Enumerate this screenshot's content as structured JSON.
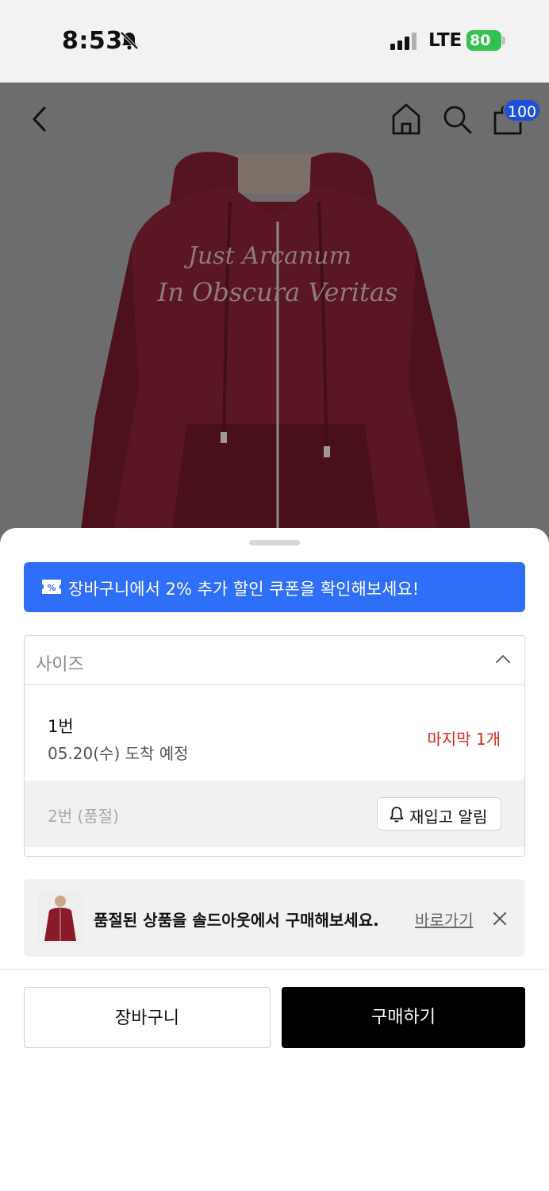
{
  "status_bar": {
    "time": "8:53",
    "network": "LTE",
    "battery": "80"
  },
  "top_nav": {
    "cart_count": "100"
  },
  "hero": {
    "print_line1": "Just Arcanum",
    "print_line2": "In Obscura Veritas"
  },
  "coupon_banner": {
    "text": "장바구니에서 2% 추가 할인 쿠폰을 확인해보세요!"
  },
  "option_select": {
    "label": "사이즈",
    "options": [
      {
        "name": "1번",
        "delivery": "05.20(수) 도착 예정",
        "stock": "마지막 1개"
      },
      {
        "name": "2번 (품절)",
        "action": "재입고 알림"
      }
    ]
  },
  "soldout_banner": {
    "message": "품절된 상품을 솔드아웃에서 구매해보세요.",
    "link": "바로가기"
  },
  "actions": {
    "cart": "장바구니",
    "buy": "구매하기"
  },
  "colors": {
    "accent_blue": "#2f6ef6",
    "badge_blue": "#1f4fd6",
    "stock_red": "#d2281d",
    "product": "#8a1a2a"
  }
}
